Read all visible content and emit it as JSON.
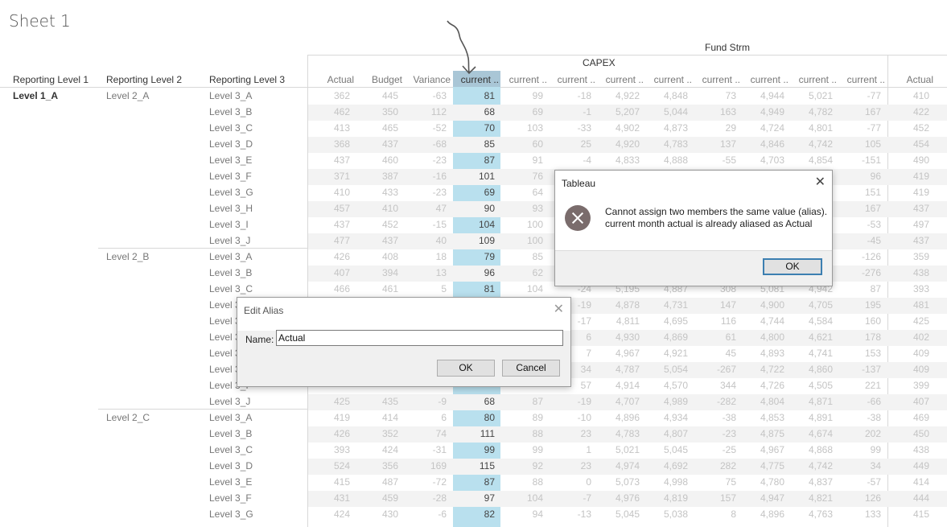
{
  "sheet_title": "Sheet 1",
  "headers": {
    "fund_strm": "Fund Strm",
    "capex": "CAPEX",
    "row_headers": [
      "Reporting Level 1",
      "Reporting Level 2",
      "Reporting Level 3"
    ],
    "columns": [
      "Actual",
      "Budget",
      "Variance",
      "current ..",
      "current ..",
      "current ..",
      "current ..",
      "current ..",
      "current ..",
      "current ..",
      "current ..",
      "current ..",
      "Actual"
    ]
  },
  "annotation": "hand-drawn arrow pointing to highlighted column header",
  "level1": [
    {
      "label": "Level 1_A"
    }
  ],
  "groups": [
    {
      "level2": "Level 2_A",
      "rows": [
        {
          "l3": "Level 3_A",
          "v": [
            "362",
            "445",
            "-63",
            "81",
            "99",
            "-18",
            "4,922",
            "4,848",
            "73",
            "4,944",
            "5,021",
            "-77",
            "410"
          ]
        },
        {
          "l3": "Level 3_B",
          "v": [
            "462",
            "350",
            "112",
            "68",
            "69",
            "-1",
            "5,207",
            "5,044",
            "163",
            "4,949",
            "4,782",
            "167",
            "422"
          ]
        },
        {
          "l3": "Level 3_C",
          "v": [
            "413",
            "465",
            "-52",
            "70",
            "103",
            "-33",
            "4,902",
            "4,873",
            "29",
            "4,724",
            "4,801",
            "-77",
            "452"
          ]
        },
        {
          "l3": "Level 3_D",
          "v": [
            "368",
            "437",
            "-68",
            "85",
            "60",
            "25",
            "4,920",
            "4,783",
            "137",
            "4,846",
            "4,742",
            "105",
            "454"
          ]
        },
        {
          "l3": "Level 3_E",
          "v": [
            "437",
            "460",
            "-23",
            "87",
            "91",
            "-4",
            "4,833",
            "4,888",
            "-55",
            "4,703",
            "4,854",
            "-151",
            "490"
          ]
        },
        {
          "l3": "Level 3_F",
          "v": [
            "371",
            "387",
            "-16",
            "101",
            "76",
            "",
            "",
            "",
            "",
            "",
            "",
            "96",
            "419"
          ]
        },
        {
          "l3": "Level 3_G",
          "v": [
            "410",
            "433",
            "-23",
            "69",
            "64",
            "",
            "",
            "",
            "",
            "",
            "",
            "151",
            "419"
          ]
        },
        {
          "l3": "Level 3_H",
          "v": [
            "457",
            "410",
            "47",
            "90",
            "93",
            "",
            "",
            "",
            "",
            "",
            "",
            "167",
            "437"
          ]
        },
        {
          "l3": "Level 3_I",
          "v": [
            "437",
            "452",
            "-15",
            "104",
            "100",
            "",
            "",
            "",
            "",
            "",
            "",
            "-53",
            "497"
          ]
        },
        {
          "l3": "Level 3_J",
          "v": [
            "477",
            "437",
            "40",
            "109",
            "100",
            "",
            "",
            "",
            "",
            "",
            "",
            "-45",
            "437"
          ]
        }
      ]
    },
    {
      "level2": "Level 2_B",
      "rows": [
        {
          "l3": "Level 3_A",
          "v": [
            "426",
            "408",
            "18",
            "79",
            "85",
            "",
            "",
            "",
            "",
            "",
            "",
            "-126",
            "359"
          ]
        },
        {
          "l3": "Level 3_B",
          "v": [
            "407",
            "394",
            "13",
            "96",
            "62",
            "",
            "",
            "",
            "",
            "",
            "",
            "-276",
            "438"
          ]
        },
        {
          "l3": "Level 3_C",
          "v": [
            "466",
            "461",
            "5",
            "81",
            "104",
            "-24",
            "5,195",
            "4,887",
            "308",
            "5,081",
            "4,942",
            "87",
            "393"
          ]
        },
        {
          "l3": "Level 3",
          "v": [
            "",
            "",
            "",
            "",
            "",
            "-19",
            "4,878",
            "4,731",
            "147",
            "4,900",
            "4,705",
            "195",
            "481"
          ]
        },
        {
          "l3": "Level 3",
          "v": [
            "",
            "",
            "",
            "",
            "",
            "-17",
            "4,811",
            "4,695",
            "116",
            "4,744",
            "4,584",
            "160",
            "425"
          ]
        },
        {
          "l3": "Level 3",
          "v": [
            "",
            "",
            "",
            "",
            "",
            "6",
            "4,930",
            "4,869",
            "61",
            "4,800",
            "4,621",
            "178",
            "402"
          ]
        },
        {
          "l3": "Level 3",
          "v": [
            "",
            "",
            "",
            "",
            "",
            "7",
            "4,967",
            "4,921",
            "45",
            "4,893",
            "4,741",
            "153",
            "409"
          ]
        },
        {
          "l3": "Level 3",
          "v": [
            "",
            "",
            "",
            "",
            "",
            "34",
            "4,787",
            "5,054",
            "-267",
            "4,722",
            "4,860",
            "-137",
            "409"
          ]
        },
        {
          "l3": "Level 3_I",
          "v": [
            "",
            "",
            "",
            "",
            "",
            "57",
            "4,914",
            "4,570",
            "344",
            "4,726",
            "4,505",
            "221",
            "399"
          ]
        },
        {
          "l3": "Level 3_J",
          "v": [
            "425",
            "435",
            "-9",
            "68",
            "87",
            "-19",
            "4,707",
            "4,989",
            "-282",
            "4,804",
            "4,871",
            "-66",
            "407"
          ]
        }
      ]
    },
    {
      "level2": "Level 2_C",
      "rows": [
        {
          "l3": "Level 3_A",
          "v": [
            "419",
            "414",
            "6",
            "80",
            "89",
            "-10",
            "4,896",
            "4,934",
            "-38",
            "4,853",
            "4,891",
            "-38",
            "469"
          ]
        },
        {
          "l3": "Level 3_B",
          "v": [
            "426",
            "352",
            "74",
            "111",
            "88",
            "23",
            "4,783",
            "4,807",
            "-23",
            "4,875",
            "4,674",
            "202",
            "450"
          ]
        },
        {
          "l3": "Level 3_C",
          "v": [
            "393",
            "424",
            "-31",
            "99",
            "99",
            "1",
            "5,021",
            "5,045",
            "-25",
            "4,967",
            "4,868",
            "99",
            "438"
          ]
        },
        {
          "l3": "Level 3_D",
          "v": [
            "524",
            "356",
            "169",
            "115",
            "92",
            "23",
            "4,974",
            "4,692",
            "282",
            "4,775",
            "4,742",
            "34",
            "449"
          ]
        },
        {
          "l3": "Level 3_E",
          "v": [
            "415",
            "487",
            "-72",
            "87",
            "88",
            "0",
            "5,073",
            "4,998",
            "75",
            "4,780",
            "4,837",
            "-57",
            "414"
          ]
        },
        {
          "l3": "Level 3_F",
          "v": [
            "431",
            "459",
            "-28",
            "97",
            "104",
            "-7",
            "4,976",
            "4,819",
            "157",
            "4,947",
            "4,821",
            "126",
            "444"
          ]
        },
        {
          "l3": "Level 3_G",
          "v": [
            "424",
            "430",
            "-6",
            "82",
            "94",
            "-13",
            "5,045",
            "5,038",
            "8",
            "4,896",
            "4,763",
            "133",
            "415"
          ]
        }
      ]
    }
  ],
  "error_dialog": {
    "title": "Tableau",
    "close": "✕",
    "line1": "Cannot assign two members the same value (alias).",
    "line2": "current month actual is already aliased as Actual",
    "ok_label": "OK",
    "icon": "error-icon"
  },
  "alias_dialog": {
    "title": "Edit Alias",
    "close": "✕",
    "name_label": "Name:",
    "name_value": "Actual",
    "ok_label": "OK",
    "cancel_label": "Cancel"
  }
}
